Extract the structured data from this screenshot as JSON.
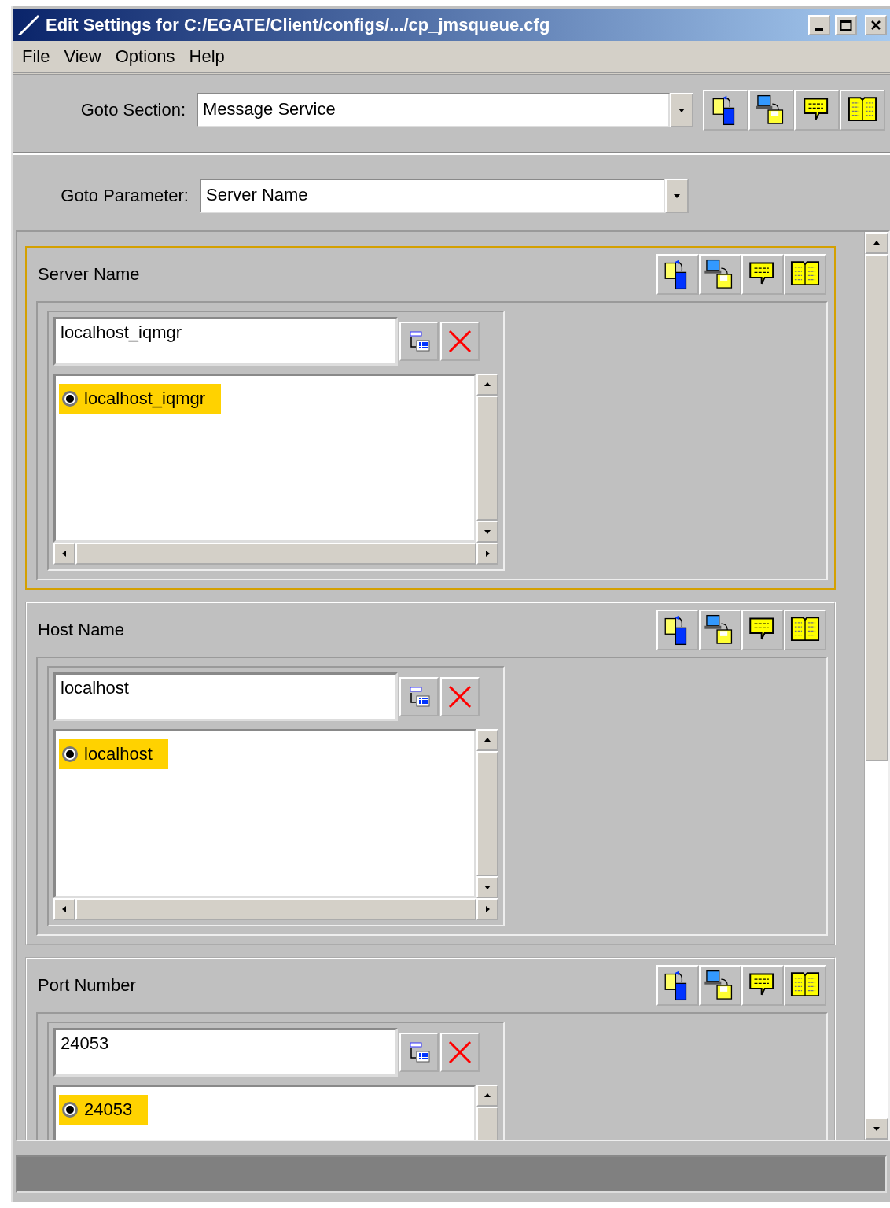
{
  "window": {
    "title": "Edit Settings for C:/EGATE/Client/configs/.../cp_jmsqueue.cfg"
  },
  "menu": [
    "File",
    "View",
    "Options",
    "Help"
  ],
  "goto_section": {
    "label": "Goto Section:",
    "value": "Message Service"
  },
  "goto_parameter": {
    "label": "Goto Parameter:",
    "value": "Server Name"
  },
  "sections": [
    {
      "title": "Server Name",
      "focused": true,
      "value": "localhost_iqmgr",
      "options": [
        {
          "label": "localhost_iqmgr",
          "selected": true
        }
      ]
    },
    {
      "title": "Host Name",
      "focused": false,
      "value": "localhost",
      "options": [
        {
          "label": "localhost",
          "selected": true
        }
      ]
    },
    {
      "title": "Port Number",
      "focused": false,
      "value": "24053",
      "options": [
        {
          "label": "24053",
          "selected": true
        }
      ]
    }
  ]
}
